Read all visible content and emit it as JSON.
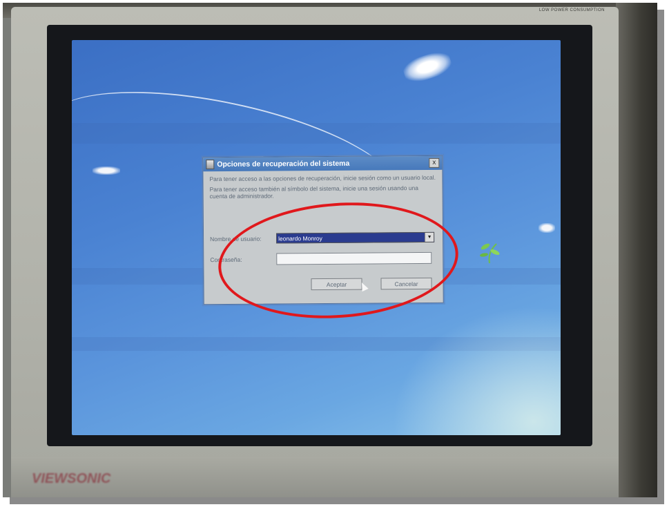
{
  "dialog": {
    "title": "Opciones de recuperación del sistema",
    "close_label": "x",
    "paragraph1": "Para tener acceso a las opciones de recuperación, inicie sesión como un usuario local.",
    "paragraph2": "Para tener acceso también al símbolo del sistema, inicie una sesión usando una cuenta de administrador.",
    "username_label": "Nombre de usuario:",
    "username_value": "leonardo Monroy",
    "password_label": "Contraseña:",
    "password_value": "",
    "accept_label": "Aceptar",
    "cancel_label": "Cancelar"
  },
  "monitor": {
    "bezel_label": "LOW POWER CONSUMPTION",
    "brand_text": "VIEWSONIC"
  },
  "colors": {
    "desktop_blue": "#4a82d2",
    "dialog_title_blue": "#4779bb",
    "highlight_ellipse": "#e0181c"
  },
  "icons": [
    "window-icon",
    "close-icon",
    "dropdown-arrow-icon",
    "mouse-cursor-icon"
  ]
}
